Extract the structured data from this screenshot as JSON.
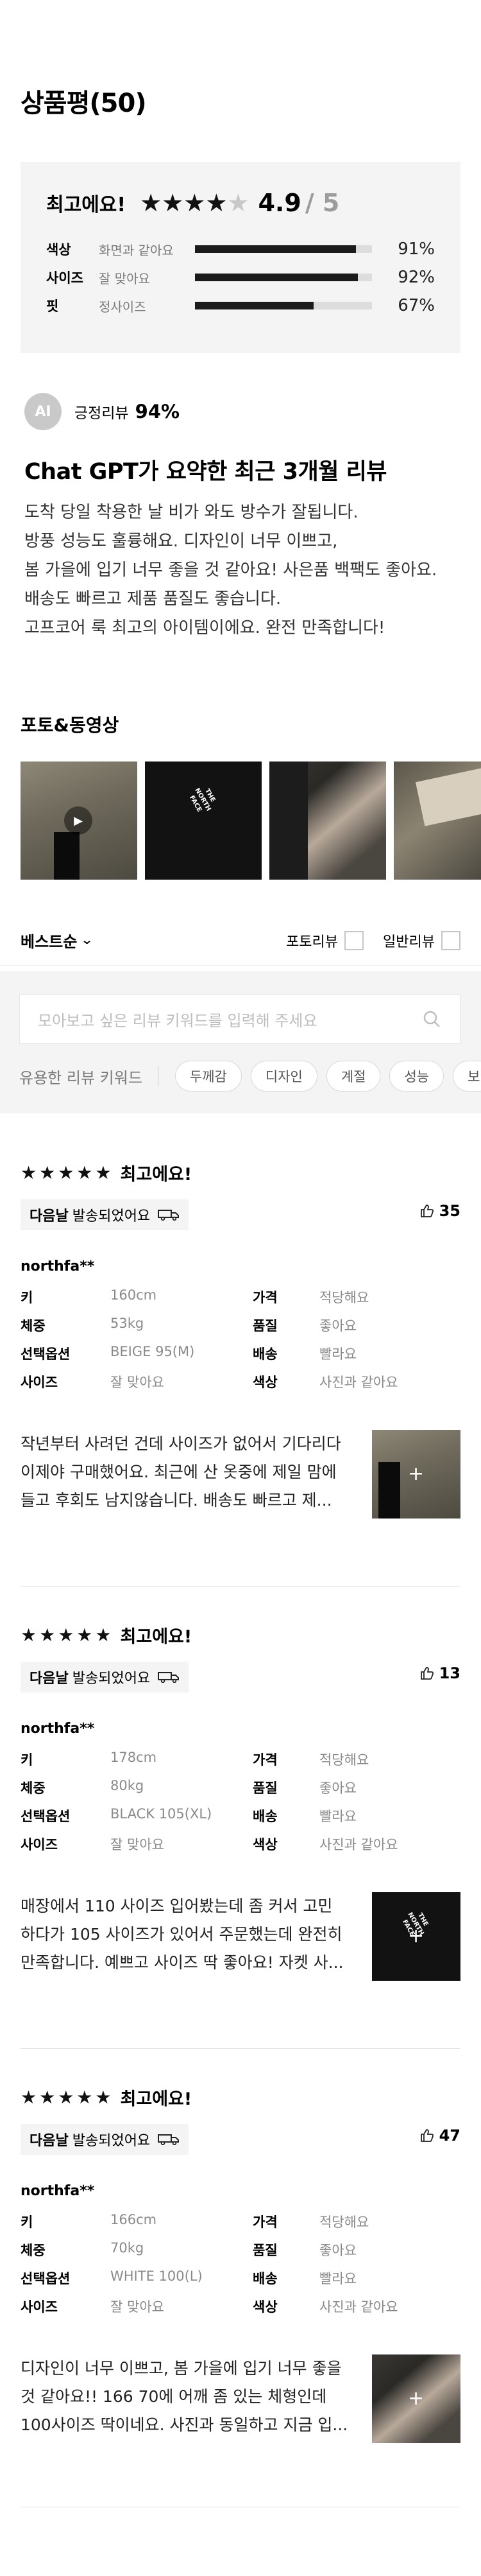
{
  "header": {
    "title": "상품평(50)"
  },
  "summary": {
    "label": "최고에요!",
    "score": "4.9",
    "score_max": "/ 5",
    "stars_filled": 4,
    "rows": [
      {
        "key": "색상",
        "value": "화면과 같아요",
        "pct": "91%",
        "fraction": 0.91
      },
      {
        "key": "사이즈",
        "value": "잘 맞아요",
        "pct": "92%",
        "fraction": 0.92
      },
      {
        "key": "핏",
        "value": "정사이즈",
        "pct": "67%",
        "fraction": 0.67
      }
    ]
  },
  "ai": {
    "badge": "AI",
    "label": "긍정리뷰",
    "pct": "94%",
    "title": "Chat GPT가 요약한 최근 3개월 리뷰",
    "lines": [
      "도착 당일 착용한 날 비가 와도 방수가 잘됩니다.",
      "방풍 성능도 훌륭해요. 디자인이 너무 이쁘고,",
      "봄 가을에 입기 너무 좋을 것 같아요! 사은품 백팩도 좋아요.",
      "배송도 빠르고 제품 품질도 좋습니다.",
      "고프코어 룩 최고의 아이템이에요. 완전 만족합니다!"
    ]
  },
  "media": {
    "title": "포토&동영상",
    "logo_text": "THE NORTH FACE"
  },
  "toolbar": {
    "sort_label": "베스트순",
    "photo_review": "포토리뷰",
    "general_review": "일반리뷰"
  },
  "search": {
    "placeholder": "모아보고 싶은 리뷰 키워드를 입력해 주세요",
    "keyword_label": "유용한 리뷰 키워드",
    "chips": [
      "두께감",
      "디자인",
      "계절",
      "성능",
      "보"
    ]
  },
  "reviews": [
    {
      "stars": "★★★★★",
      "label": "최고에요!",
      "ship_bold": "다음날",
      "ship_text": "발송되었어요",
      "likes": "35",
      "user": "northfa**",
      "info": [
        {
          "k": "키",
          "v": "160cm"
        },
        {
          "k": "가격",
          "v": "적당해요"
        },
        {
          "k": "체중",
          "v": "53kg"
        },
        {
          "k": "품질",
          "v": "좋아요"
        },
        {
          "k": "선택옵션",
          "v": "BEIGE 95(M)"
        },
        {
          "k": "배송",
          "v": "빨라요"
        },
        {
          "k": "사이즈",
          "v": "잘 맞아요"
        },
        {
          "k": "색상",
          "v": "사진과 같아요"
        }
      ],
      "lines": [
        "작년부터 사려던 건데 사이즈가 없어서 기다리다",
        "이제야 구매했어요. 최근에 산 옷중에 제일 맘에",
        "들고 후회도 남지않습니다. 배송도 빠르고 제..."
      ],
      "plus": "+"
    },
    {
      "stars": "★★★★★",
      "label": "최고에요!",
      "ship_bold": "다음날",
      "ship_text": "발송되었어요",
      "likes": "13",
      "user": "northfa**",
      "info": [
        {
          "k": "키",
          "v": "178cm"
        },
        {
          "k": "가격",
          "v": "적당해요"
        },
        {
          "k": "체중",
          "v": "80kg"
        },
        {
          "k": "품질",
          "v": "좋아요"
        },
        {
          "k": "선택옵션",
          "v": "BLACK 105(XL)"
        },
        {
          "k": "배송",
          "v": "빨라요"
        },
        {
          "k": "사이즈",
          "v": "잘 맞아요"
        },
        {
          "k": "색상",
          "v": "사진과 같아요"
        }
      ],
      "lines": [
        "매장에서 110 사이즈 입어봤는데 좀 커서 고민",
        "하다가 105 사이즈가 있어서 주문했는데 완전히",
        "만족합니다. 예쁘고 사이즈 딱 좋아요! 자켓 사..."
      ],
      "plus": "+"
    },
    {
      "stars": "★★★★★",
      "label": "최고에요!",
      "ship_bold": "다음날",
      "ship_text": "발송되었어요",
      "likes": "47",
      "user": "northfa**",
      "info": [
        {
          "k": "키",
          "v": "166cm"
        },
        {
          "k": "가격",
          "v": "적당해요"
        },
        {
          "k": "체중",
          "v": "70kg"
        },
        {
          "k": "품질",
          "v": "좋아요"
        },
        {
          "k": "선택옵션",
          "v": "WHITE 100(L)"
        },
        {
          "k": "배송",
          "v": "빨라요"
        },
        {
          "k": "사이즈",
          "v": "잘 맞아요"
        },
        {
          "k": "색상",
          "v": "사진과 같아요"
        }
      ],
      "lines": [
        "디자인이 너무 이쁘고, 봄 가을에 입기 너무 좋을",
        "것 같아요!! 166 70에 어깨 좀 있는 체형인데",
        "100사이즈 딱이네요. 사진과 동일하고 지금 입..."
      ],
      "plus": "+"
    }
  ]
}
